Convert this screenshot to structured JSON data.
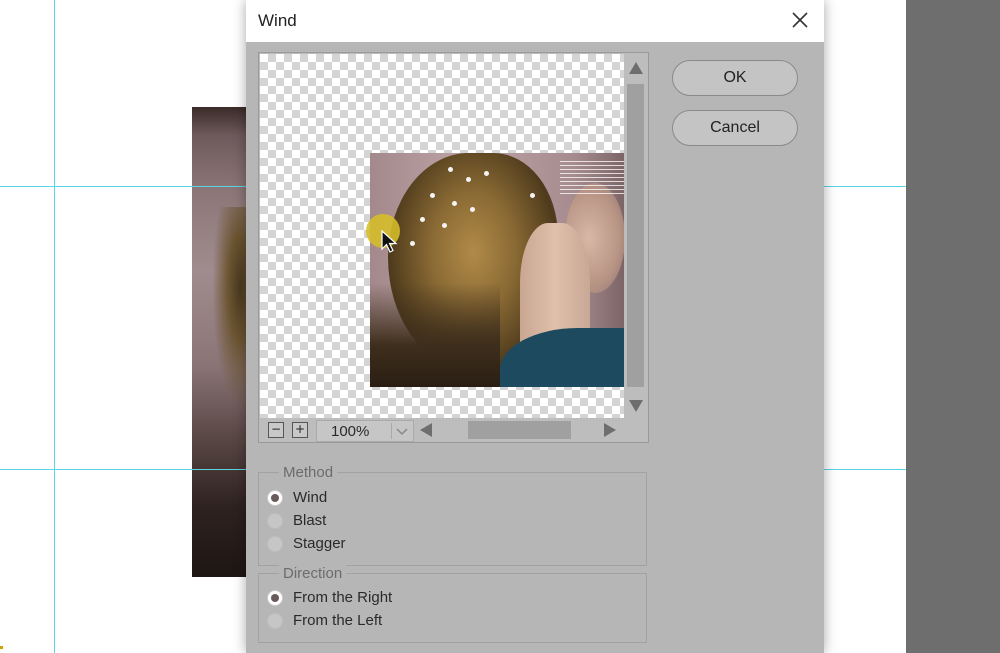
{
  "dialog": {
    "title": "Wind",
    "close_icon": "close-icon"
  },
  "preview": {
    "zoom_value": "100%",
    "zoom_out_glyph": "−",
    "zoom_in_glyph": "+"
  },
  "buttons": {
    "ok_label": "OK",
    "cancel_label": "Cancel"
  },
  "method": {
    "label": "Method",
    "options": [
      "Wind",
      "Blast",
      "Stagger"
    ],
    "selected": "Wind"
  },
  "direction": {
    "label": "Direction",
    "options": [
      "From the Right",
      "From the Left"
    ],
    "selected": "From the Right"
  },
  "colors": {
    "guide": "#5ad6e6",
    "dialog_bg": "#b6b6b6",
    "radio_selected_dot": "#6a5a5a",
    "cursor_highlight": "#d6be28"
  }
}
